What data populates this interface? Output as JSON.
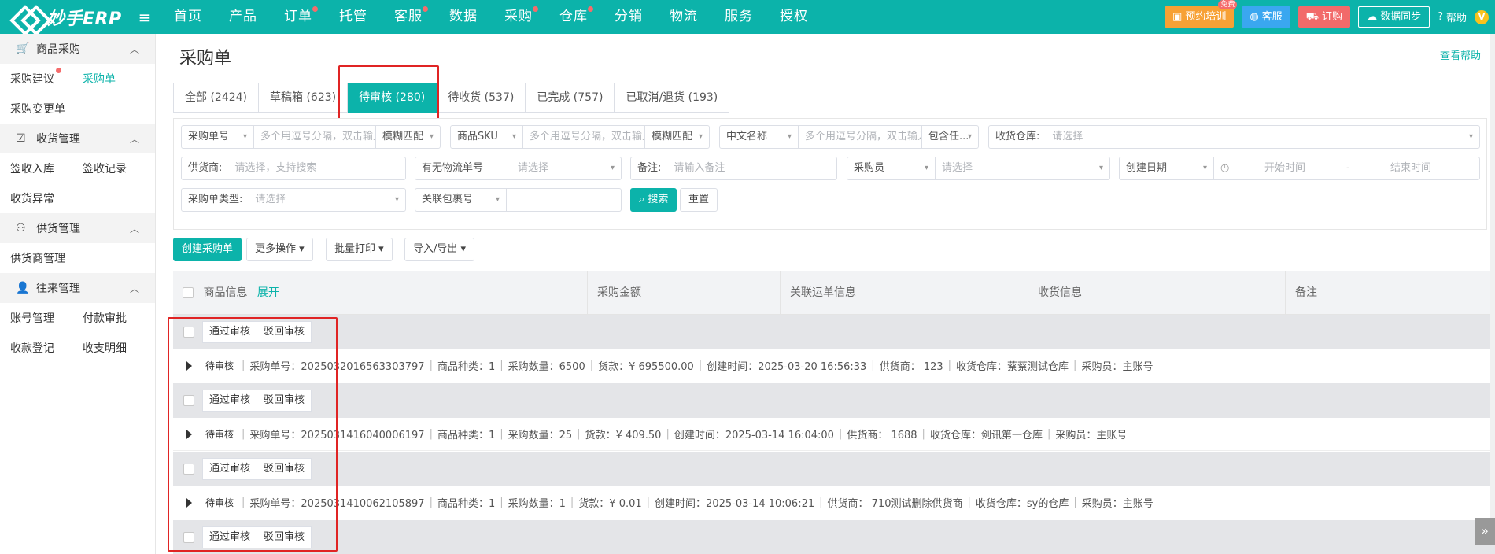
{
  "header": {
    "logo_text": "妙手ERP",
    "menu_icon": "hamburger-icon",
    "nav": [
      {
        "label": "首页",
        "dot": false
      },
      {
        "label": "产品",
        "dot": false
      },
      {
        "label": "订单",
        "dot": true
      },
      {
        "label": "托管",
        "dot": false
      },
      {
        "label": "客服",
        "dot": true
      },
      {
        "label": "数据",
        "dot": false
      },
      {
        "label": "采购",
        "dot": true
      },
      {
        "label": "仓库",
        "dot": true
      },
      {
        "label": "分销",
        "dot": false
      },
      {
        "label": "物流",
        "dot": false
      },
      {
        "label": "服务",
        "dot": false
      },
      {
        "label": "授权",
        "dot": false
      }
    ],
    "training": "预约培训",
    "training_tag": "免费",
    "customer_service": "客服",
    "order": "订购",
    "data_sync": "数据同步",
    "help": "帮助",
    "avatar_letter": "V",
    "colors": {
      "bar": "#0cb3aa",
      "training": "#f7a135",
      "cs": "#3aa7f0",
      "order": "#f26a6a"
    }
  },
  "sidebar": {
    "groups": [
      {
        "title": "商品采购",
        "icon": "cart-icon",
        "rows": [
          [
            "采购建议",
            "采购单"
          ],
          [
            "采购变更单"
          ]
        ]
      },
      {
        "title": "收货管理",
        "icon": "clipboard-check-icon",
        "rows": [
          [
            "签收入库",
            "签收记录"
          ],
          [
            "收货异常"
          ]
        ]
      },
      {
        "title": "供货管理",
        "icon": "supplier-icon",
        "rows": [
          [
            "供货商管理"
          ]
        ]
      },
      {
        "title": "往来管理",
        "icon": "user-icon",
        "rows": [
          [
            "账号管理",
            "付款审批"
          ],
          [
            "收款登记",
            "收支明细"
          ]
        ]
      }
    ],
    "active": "采购单"
  },
  "page": {
    "title": "采购单",
    "help_link": "查看帮助",
    "tabs": [
      "全部 (2424)",
      "草稿箱 (623)",
      "待审核 (280)",
      "待收货 (537)",
      "已完成 (757)",
      "已取消/退货 (193)"
    ],
    "active_tab": 2
  },
  "filters": {
    "order_no_select": "采购单号",
    "order_no_ph": "多个用逗号分隔，双击输入更多",
    "match1": "模糊匹配",
    "sku_select": "商品SKU",
    "sku_ph": "多个用逗号分隔，双击输入更多",
    "match2": "模糊匹配",
    "name_select": "中文名称",
    "name_ph": "多个用逗号分隔，双击输入更多",
    "contains": "包含任...",
    "warehouse_label": "收货仓库:",
    "warehouse_ph": "请选择",
    "supplier_label": "供货商:",
    "supplier_ph": "请选择，支持搜索",
    "logistics_label": "有无物流单号",
    "logistics_ph": "请选择",
    "remark_label": "备注:",
    "remark_ph": "请输入备注",
    "buyer_label": "采购员",
    "buyer_ph": "请选择",
    "date_select": "创建日期",
    "start_ph": "开始时间",
    "range_sep": "-",
    "end_ph": "结束时间",
    "type_label": "采购单类型:",
    "type_ph": "请选择",
    "package_label": "关联包裹号",
    "search_btn": "搜索",
    "reset_btn": "重置"
  },
  "toolbar": {
    "create": "创建采购单",
    "more": "更多操作",
    "print": "批量打印",
    "import_export": "导入/导出"
  },
  "table": {
    "columns": [
      "商品信息",
      "采购金额",
      "关联运单信息",
      "收货信息",
      "备注"
    ],
    "expand": "展开",
    "approve": "通过审核",
    "reject": "驳回审核",
    "rows": [
      {
        "status": "待审核",
        "order_no": "采购单号：2025032016563303797",
        "kinds": "商品种类：1",
        "qty": "采购数量：6500",
        "amount": "货款：¥ 695500.00",
        "created": "创建时间：2025-03-20 16:56:33",
        "supplier": "供货商： 123",
        "warehouse": "收货仓库：蔡蔡测试仓库",
        "buyer": "采购员：主账号"
      },
      {
        "status": "待审核",
        "order_no": "采购单号：2025031416040006197",
        "kinds": "商品种类：1",
        "qty": "采购数量：25",
        "amount": "货款：¥ 409.50",
        "created": "创建时间：2025-03-14 16:04:00",
        "supplier": "供货商： 1688",
        "warehouse": "收货仓库：剑讯第一仓库",
        "buyer": "采购员：主账号"
      },
      {
        "status": "待审核",
        "order_no": "采购单号：2025031410062105897",
        "kinds": "商品种类：1",
        "qty": "采购数量：1",
        "amount": "货款：¥ 0.01",
        "created": "创建时间：2025-03-14 10:06:21",
        "supplier": "供货商： 710测试删除供货商",
        "warehouse": "收货仓库：sy的仓库",
        "buyer": "采购员：主账号"
      }
    ]
  }
}
